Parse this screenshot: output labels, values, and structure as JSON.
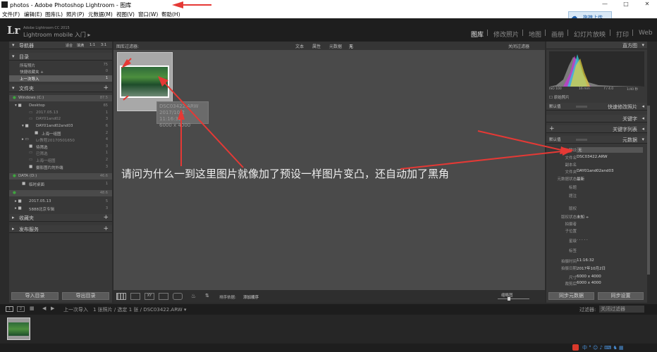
{
  "window": {
    "title": "photos - Adobe Photoshop Lightroom - 图库"
  },
  "menu": [
    "文件(F)",
    "编辑(E)",
    "图库(L)",
    "照片(P)",
    "元数据(M)",
    "视图(V)",
    "窗口(W)",
    "帮助(H)"
  ],
  "cloud_button": "拖拽上传",
  "identity": {
    "logo": "Lr",
    "line1": "Adobe Lightroom CC 2015",
    "line2": "Lightroom mobile 入门 ▸"
  },
  "modules": [
    "图库",
    "修改照片",
    "地图",
    "画册",
    "幻灯片放映",
    "打印",
    "Web"
  ],
  "left_panel": {
    "navigator": "导航器",
    "nav_zoom": [
      "适合",
      "填满",
      "1:1",
      "3:1"
    ],
    "catalog": "目录",
    "catalog_items": [
      {
        "label": "所有照片",
        "count": "75"
      },
      {
        "label": "快捷收藏夹 +",
        "count": "0"
      },
      {
        "label": "上一次导入",
        "count": "1"
      }
    ],
    "folders": "文件夹",
    "drives": [
      {
        "label": "Windows (C:)",
        "count": "87.5"
      },
      {
        "label": "DATA (D:)",
        "count": "46.6"
      },
      {
        "label": "",
        "count": "48.6"
      }
    ],
    "folder_items": [
      {
        "label": "Desktop",
        "count": "65"
      },
      {
        "label": "2017.05.13",
        "count": "1"
      },
      {
        "label": "DAY01and02",
        "count": "3"
      },
      {
        "label": "DAY01and02and03",
        "count": "6"
      },
      {
        "label": "上海一组图",
        "count": "2"
      },
      {
        "label": "Lr教程20170501650",
        "count": "4"
      },
      {
        "label": "待筛选",
        "count": "3"
      },
      {
        "label": "已筛选",
        "count": "1"
      },
      {
        "label": "上海一组图",
        "count": "2"
      },
      {
        "label": "摄影图片的外端",
        "count": "3"
      },
      {
        "label": "临时桌面",
        "count": "1"
      },
      {
        "label": "2017.05.13",
        "count": "5"
      },
      {
        "label": "5888北京专辑",
        "count": "3"
      }
    ],
    "collections": "收藏夹",
    "publish": "发布服务",
    "import_btn": "导入目录",
    "export_btn": "导出目录"
  },
  "filter_bar": {
    "label": "图库过滤器:",
    "opts": [
      "文本",
      "属性",
      "元数据",
      "无"
    ],
    "custom": "关闭过滤器"
  },
  "tooltip": [
    "DSC03422.ARW",
    "2017/10/2 11:16:32",
    "6000 x 4000"
  ],
  "question": "请问为什么一到这里图片就像加了预设一样图片变凸，还自动加了黑角",
  "toolbar": {
    "sort_label": "排序依据:",
    "sort_value": "添加顺序",
    "thumb_label": "缩略图"
  },
  "filmstrip_bar": {
    "source": "上一次导入",
    "info": "1 张照片 / 选定 1 张 / DSC03422.ARW ▾",
    "filter_label": "过滤器:",
    "filter_value": "关闭过滤器"
  },
  "right_panel": {
    "histogram": "直方图",
    "hist_info": [
      "ISO 100",
      "16 mm",
      "f / 4.0",
      "1/40 秒"
    ],
    "original_photo": "原始照片",
    "quick_develop": "快速修改照片",
    "default_label": "默认值",
    "keywords": "关键字",
    "keyword_list": "关键字列表",
    "metadata": "元数据",
    "preset_label": "预设",
    "preset_value": "无",
    "metadata_rows": [
      {
        "label": "文件名",
        "value": "DSC03422.ARW"
      },
      {
        "label": "副本名",
        "value": ""
      },
      {
        "label": "文件夹",
        "value": "DAY01and02and03"
      },
      {
        "label": "元数据状态",
        "value": "最新"
      },
      {
        "label": "标题",
        "value": ""
      },
      {
        "label": "题注",
        "value": ""
      },
      {
        "label": "版权",
        "value": ""
      },
      {
        "label": "版权状态",
        "value": "未知 ÷"
      },
      {
        "label": "拍摄者",
        "value": ""
      },
      {
        "label": "子位置",
        "value": ""
      },
      {
        "label": "星级",
        "value": "· · · · ·"
      },
      {
        "label": "标签",
        "value": ""
      },
      {
        "label": "拍摄时间",
        "value": "11:16:32"
      },
      {
        "label": "拍摄日期",
        "value": "2017年10月2日"
      },
      {
        "label": "尺寸",
        "value": "6000 x 4000"
      },
      {
        "label": "裁剪后",
        "value": "6000 x 4000"
      }
    ],
    "sync_meta": "同步元数据",
    "sync_settings": "同步设置"
  },
  "colors": {
    "annotation": "#e53935",
    "panel": "#383838",
    "center": "#4a4a4a"
  }
}
